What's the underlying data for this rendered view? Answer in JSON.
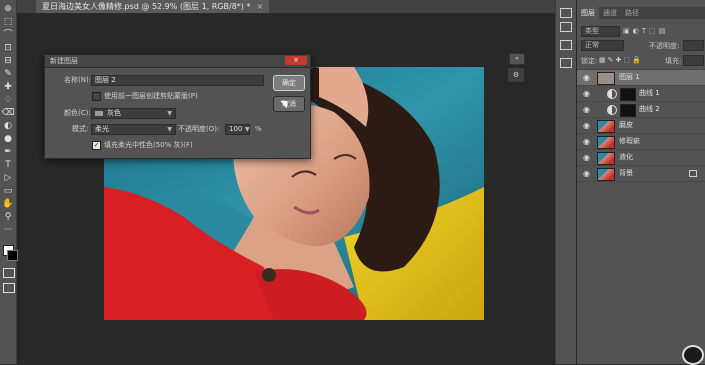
{
  "document": {
    "tab_title": "夏日海边美女人像精修.psd @ 52.9% (图层 1, RGB/8*) *",
    "tab_close": "×"
  },
  "toolbar": {
    "tools": [
      "⊕",
      "⬚",
      "⌒",
      "⊡",
      "⊟",
      "✎",
      "✚",
      "♢",
      "⌫",
      "◐",
      "●",
      "✒",
      "T",
      "▷",
      "▭",
      "✋",
      "⚲",
      "⋯"
    ]
  },
  "panel": {
    "tabs": [
      "图层",
      "通道",
      "路径"
    ],
    "kind_label": "类型",
    "blend_mode": "正常",
    "opacity_label": "不透明度:",
    "lock_label": "锁定:",
    "fill_label": "填充:",
    "layers": [
      {
        "name": "图层 1",
        "active": true,
        "type": "pixel",
        "thumb_color": "#9a8f86"
      },
      {
        "name": "曲线 1",
        "active": false,
        "type": "adjustment",
        "thumb_color": "#111111"
      },
      {
        "name": "曲线 2",
        "active": false,
        "type": "adjustment",
        "thumb_color": "#111111"
      },
      {
        "name": "磨皮",
        "active": false,
        "type": "pixel",
        "thumb_color": "#b46a5a"
      },
      {
        "name": "修瑕疵",
        "active": false,
        "type": "pixel",
        "thumb_color": "#b46a5a"
      },
      {
        "name": "液化",
        "active": false,
        "type": "pixel",
        "thumb_color": "#b46a5a"
      },
      {
        "name": "背景",
        "active": false,
        "type": "pixel",
        "thumb_color": "#b46a5a",
        "locked": true
      }
    ]
  },
  "dialog": {
    "title": "新建图层",
    "close": "×",
    "name_label": "名称(N):",
    "name_value": "图层 2",
    "clip_label": "使用前一图层创建剪贴蒙版(P)",
    "clip_checked": false,
    "color_label": "颜色(C):",
    "color_value": "灰色",
    "mode_label": "模式:",
    "mode_value": "柔光",
    "opacity_label": "不透明度(O):",
    "opacity_value": "100",
    "opacity_unit": "%",
    "fill_label": "填充柔光中性色(50% 灰)(F)",
    "fill_checked": true,
    "ok_label": "确定",
    "cancel_label": "取消"
  }
}
